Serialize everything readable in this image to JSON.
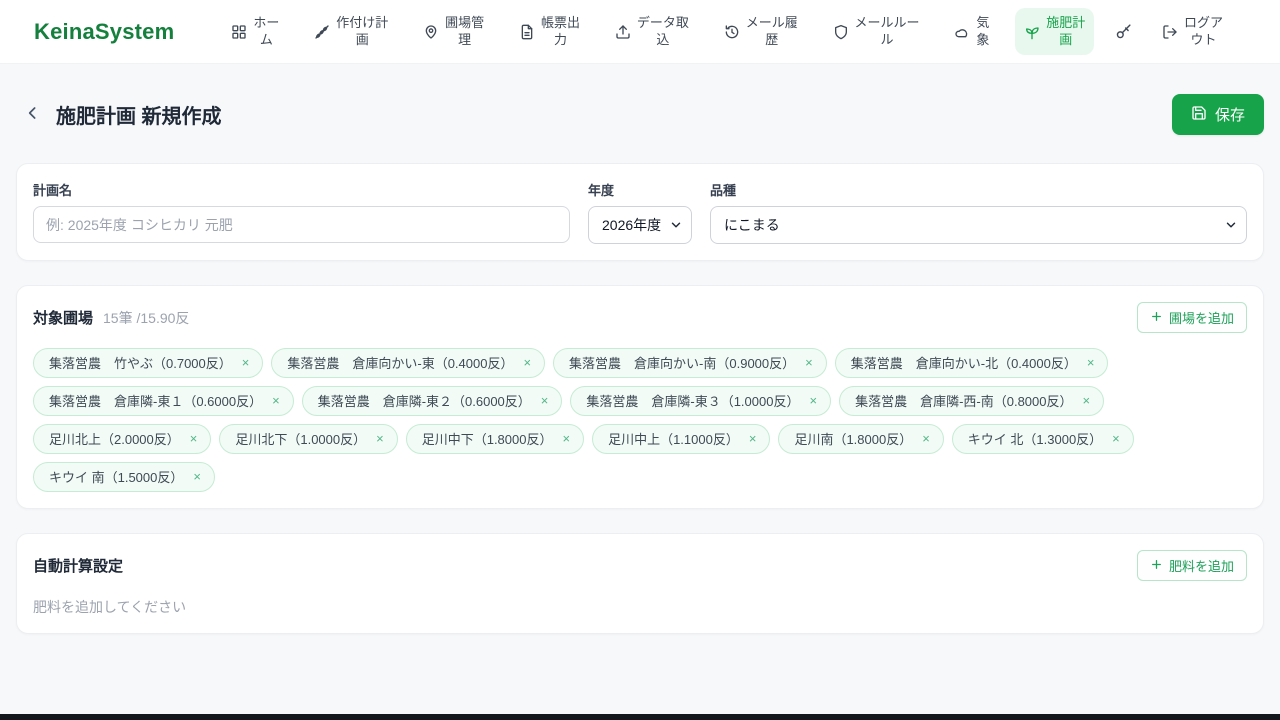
{
  "brand": "KeinaSystem",
  "nav": {
    "items": [
      {
        "label": "ホー\nム",
        "icon": "grid-icon",
        "active": false
      },
      {
        "label": "作付け計\n画",
        "icon": "wheat-icon",
        "active": false
      },
      {
        "label": "圃場管\n理",
        "icon": "map-pin-icon",
        "active": false
      },
      {
        "label": "帳票出\n力",
        "icon": "document-icon",
        "active": false
      },
      {
        "label": "データ取\n込",
        "icon": "upload-icon",
        "active": false
      },
      {
        "label": "メール履\n歴",
        "icon": "history-icon",
        "active": false
      },
      {
        "label": "メールルー\nル",
        "icon": "shield-icon",
        "active": false
      },
      {
        "label": "気\n象",
        "icon": "cloud-icon",
        "active": false
      },
      {
        "label": "施肥計\n画",
        "icon": "sprout-icon",
        "active": true
      },
      {
        "label": "",
        "icon": "key-icon",
        "active": false
      },
      {
        "label": "ログア\nウト",
        "icon": "logout-icon",
        "active": false
      }
    ]
  },
  "header": {
    "title": "施肥計画 新規作成",
    "save_label": "保存",
    "save_icon": "floppy-icon",
    "back_icon": "chevron-left-icon"
  },
  "form": {
    "plan_name_label": "計画名",
    "plan_name_value": "",
    "plan_name_placeholder": "例: 2025年度 コシヒカリ 元肥",
    "year_label": "年度",
    "year_value": "2026年度",
    "variety_label": "品種",
    "variety_value": "にこまる"
  },
  "fields_section": {
    "title": "対象圃場",
    "summary": "15筆 /15.90反",
    "add_button_label": "圃場を追加",
    "remove_icon": "×",
    "tags": [
      "集落営農　竹やぶ（0.7000反）",
      "集落営農　倉庫向かい-東（0.4000反）",
      "集落営農　倉庫向かい-南（0.9000反）",
      "集落営農　倉庫向かい-北（0.4000反）",
      "集落営農　倉庫隣-東１（0.6000反）",
      "集落営農　倉庫隣-東２（0.6000反）",
      "集落営農　倉庫隣-東３（1.0000反）",
      "集落営農　倉庫隣-西-南（0.8000反）",
      "足川北上（2.0000反）",
      "足川北下（1.0000反）",
      "足川中下（1.8000反）",
      "足川中上（1.1000反）",
      "足川南（1.8000反）",
      "キウイ 北（1.3000反）",
      "キウイ 南（1.5000反）"
    ]
  },
  "auto_calc_section": {
    "title": "自動計算設定",
    "add_button_label": "肥料を追加",
    "empty_message": "肥料を追加してください"
  },
  "colors": {
    "brand_green": "#15803d",
    "accent_green": "#17a34a",
    "active_nav_bg": "#e9f8ef",
    "tag_bg": "#f2fbf5",
    "tag_border": "#c5ecd4",
    "muted_text": "#9ca3af"
  }
}
